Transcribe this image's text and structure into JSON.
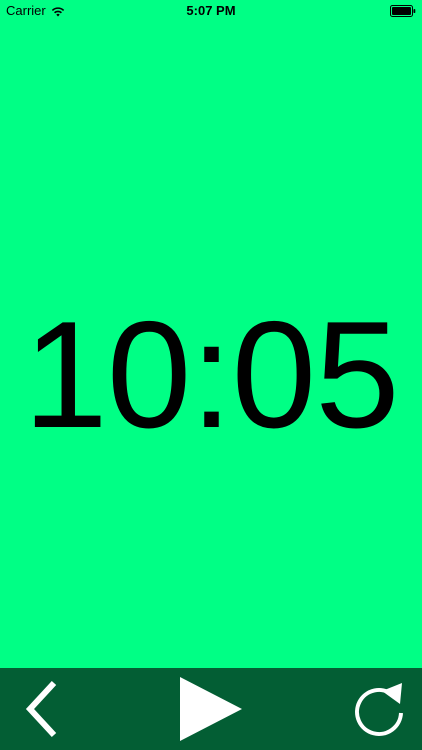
{
  "status_bar": {
    "carrier": "Carrier",
    "time": "5:07 PM",
    "icons": [
      "wifi-icon",
      "battery-icon"
    ]
  },
  "timer": {
    "display": "10:05"
  },
  "toolbar": {
    "buttons": [
      {
        "name": "back-button",
        "icon": "chevron-left-icon"
      },
      {
        "name": "play-button",
        "icon": "play-icon"
      },
      {
        "name": "reset-button",
        "icon": "refresh-icon"
      }
    ]
  },
  "colors": {
    "background": "#00FF85",
    "toolbar": "#035E34",
    "icon": "#FFFFFF",
    "text": "#000000"
  }
}
